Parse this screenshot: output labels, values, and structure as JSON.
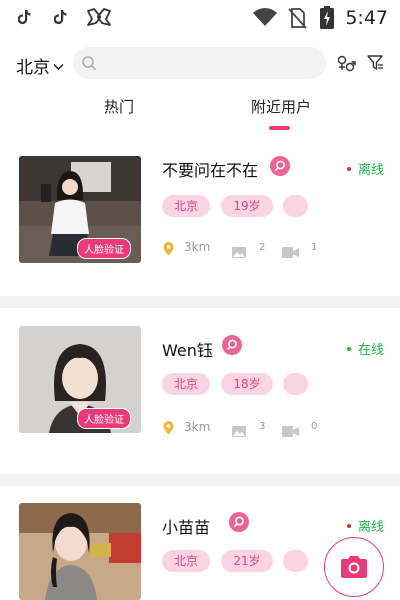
{
  "status_bar": {
    "time": "5:47",
    "left_icons": [
      "tiktok-icon",
      "tiktok-icon",
      "kuaishou-icon"
    ],
    "right_icons": [
      "wifi-icon",
      "no-sim-icon",
      "battery-icon"
    ]
  },
  "header": {
    "city": "北京",
    "search_placeholder": ""
  },
  "tabs": [
    {
      "label": "热门",
      "active": false
    },
    {
      "label": "附近用户",
      "active": true
    }
  ],
  "colors": {
    "accent": "#ea3b79",
    "chip_bg": "#fbd4e4",
    "online": "#22b34a",
    "offline_text": "#22b34a",
    "offline_dot": "#c0392b"
  },
  "users": [
    {
      "name": "不要问在不在",
      "status": "离线",
      "online": false,
      "city": "北京",
      "age": "19岁",
      "distance": "3km",
      "photos": "2",
      "videos": "1",
      "verified": "人脸验证"
    },
    {
      "name": "Wen钰",
      "status": "在线",
      "online": true,
      "city": "北京",
      "age": "18岁",
      "distance": "3km",
      "photos": "3",
      "videos": "0",
      "verified": "人脸验证"
    },
    {
      "name": "小苗苗",
      "status": "离线",
      "online": false,
      "city": "北京",
      "age": "21岁",
      "distance": "",
      "photos": "",
      "videos": "",
      "verified": ""
    }
  ]
}
